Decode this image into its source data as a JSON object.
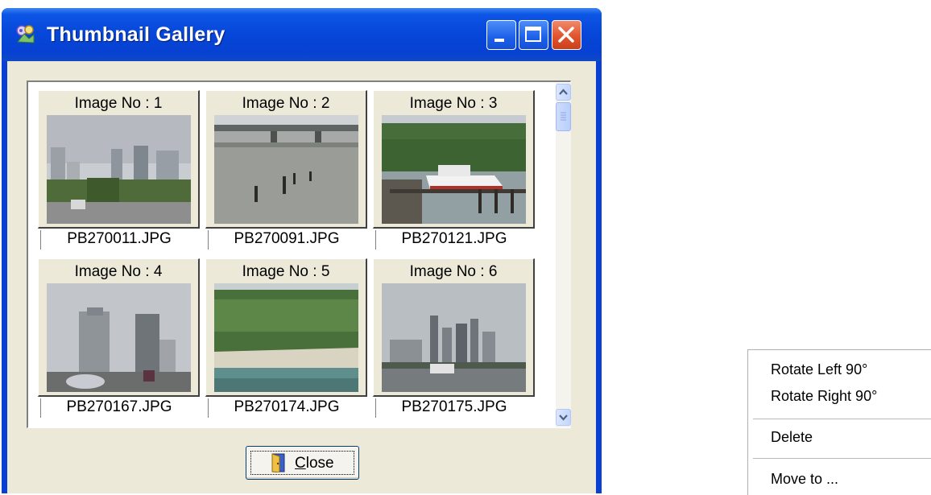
{
  "window": {
    "title": "Thumbnail Gallery",
    "buttons": {
      "minimize": "minimize",
      "maximize": "maximize",
      "close": "close"
    }
  },
  "gallery": {
    "items": [
      {
        "label": "Image No : 1",
        "file": "PB270011.JPG"
      },
      {
        "label": "Image No : 2",
        "file": "PB270091.JPG"
      },
      {
        "label": "Image No : 3",
        "file": "PB270121.JPG"
      },
      {
        "label": "Image No : 4",
        "file": "PB270167.JPG"
      },
      {
        "label": "Image No : 5",
        "file": "PB270174.JPG"
      },
      {
        "label": "Image No : 6",
        "file": "PB270175.JPG"
      }
    ]
  },
  "footer": {
    "close_label": "Close",
    "close_accel": "C",
    "close_rest": "lose"
  },
  "context_menu": {
    "items": [
      "Rotate Left 90°",
      "Rotate Right 90°",
      "Delete",
      "Move to ..."
    ]
  },
  "icons": {
    "app": "gallery-app-icon",
    "close_button": "exit-door-icon",
    "scroll_up": "chevron-up-icon",
    "scroll_down": "chevron-down-icon"
  },
  "colors": {
    "titlebar": "#0646d8",
    "face": "#ece9d8",
    "close": "#e2542c"
  }
}
